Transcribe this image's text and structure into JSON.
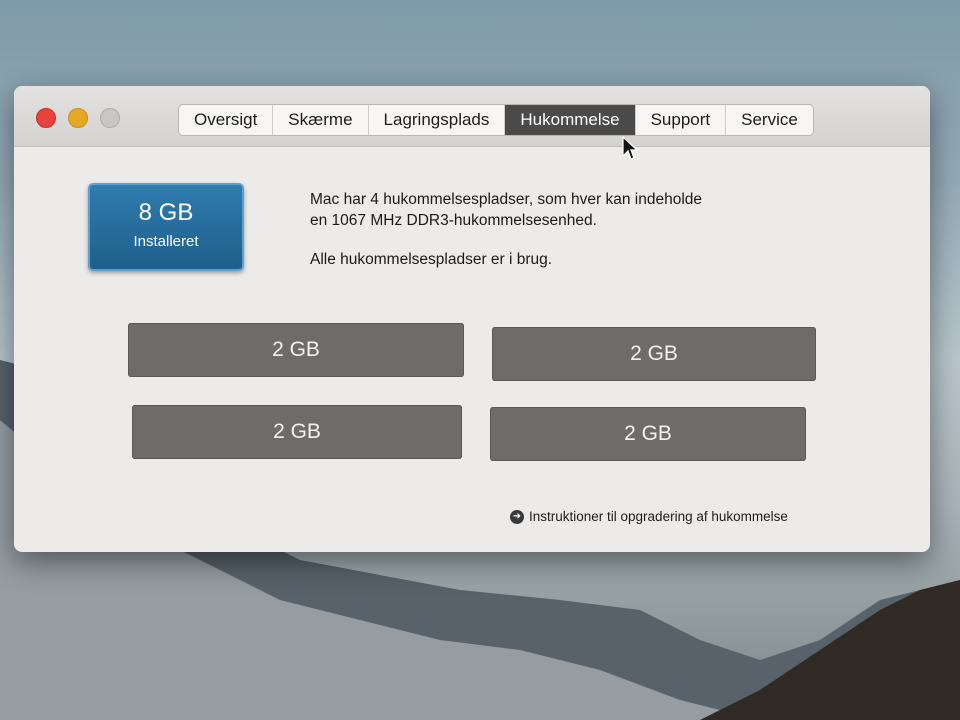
{
  "window": {
    "tabs": [
      {
        "label": "Oversigt"
      },
      {
        "label": "Skærme"
      },
      {
        "label": "Lagringsplads"
      },
      {
        "label": "Hukommelse",
        "active": true
      },
      {
        "label": "Support"
      },
      {
        "label": "Service"
      }
    ]
  },
  "memory": {
    "installed_size": "8 GB",
    "installed_label": "Installeret",
    "description_line1": "Mac har 4 hukommelsespladser, som hver kan indeholde",
    "description_line2": "en 1067 MHz DDR3-hukommelsesenhed.",
    "status": "Alle hukommelsespladser er i brug.",
    "slots": [
      "2 GB",
      "2 GB",
      "2 GB",
      "2 GB"
    ],
    "upgrade_link": "Instruktioner til opgradering af hukommelse"
  },
  "colors": {
    "installed_box": "#2a6fa0",
    "slot": "#6d6c6a",
    "active_tab": "#4a4a4a"
  },
  "icons": [
    "close-icon",
    "minimize-icon",
    "zoom-icon",
    "arrow-circle-icon",
    "pointer-icon"
  ]
}
